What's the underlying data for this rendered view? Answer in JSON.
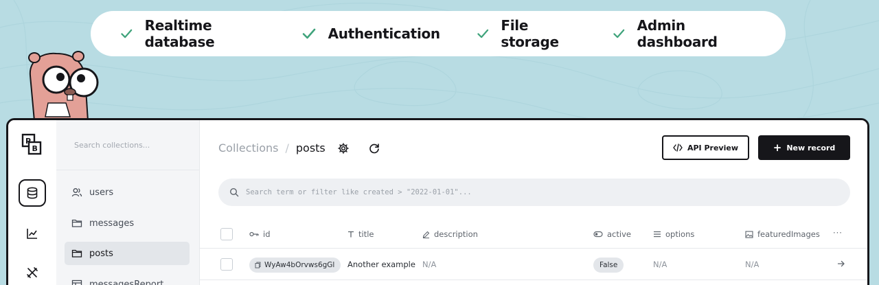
{
  "features": [
    {
      "label": "Realtime database",
      "icon": "check-icon"
    },
    {
      "label": "Authentication",
      "icon": "check-icon"
    },
    {
      "label": "File storage",
      "icon": "check-icon"
    },
    {
      "label": "Admin dashboard",
      "icon": "check-icon"
    }
  ],
  "colors": {
    "background": "#b8dce3",
    "accent_check": "#3fa37b",
    "dark": "#16161a",
    "sidebar_bg": "#f4f5f7"
  },
  "app": {
    "logo_text": "PB",
    "rail": [
      {
        "icon": "database-icon",
        "active": true
      },
      {
        "icon": "chart-icon",
        "active": false
      },
      {
        "icon": "tools-icon",
        "active": false
      }
    ],
    "sidebar": {
      "search_placeholder": "Search collections...",
      "items": [
        {
          "label": "users",
          "icon": "users-icon",
          "active": false
        },
        {
          "label": "messages",
          "icon": "folder-icon",
          "active": false
        },
        {
          "label": "posts",
          "icon": "folder-icon",
          "active": true
        },
        {
          "label": "messagesReport",
          "icon": "table-icon",
          "active": false
        }
      ]
    },
    "header": {
      "breadcrumb_root": "Collections",
      "breadcrumb_separator": "/",
      "breadcrumb_current": "posts",
      "api_preview_label": "API Preview",
      "new_record_label": "New record",
      "new_record_icon": "+"
    },
    "search": {
      "placeholder": "Search term or filter like created > \"2022-01-01\"..."
    },
    "table": {
      "columns": [
        {
          "label": "id",
          "icon": "key-icon"
        },
        {
          "label": "title",
          "icon": "text-icon"
        },
        {
          "label": "description",
          "icon": "edit-icon"
        },
        {
          "label": "active",
          "icon": "toggle-icon"
        },
        {
          "label": "options",
          "icon": "list-icon"
        },
        {
          "label": "featuredImages",
          "icon": "image-icon"
        }
      ],
      "more_label": "···",
      "rows": [
        {
          "id": "WyAw4bOrvws6gGl",
          "title": "Another example",
          "description": "N/A",
          "active": "False",
          "options": "N/A",
          "featuredImages": "N/A"
        }
      ]
    }
  }
}
